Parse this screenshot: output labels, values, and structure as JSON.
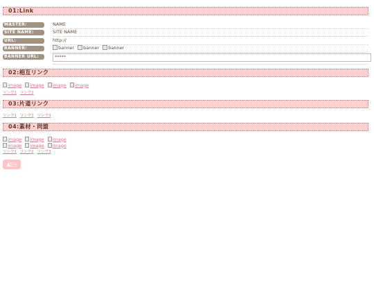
{
  "sections": {
    "link": {
      "title": "01:Link"
    },
    "mutual": {
      "title": "02:相互リンク"
    },
    "oneway": {
      "title": "03:片道リンク"
    },
    "material": {
      "title": "04:素材・同盟"
    }
  },
  "info": {
    "master": {
      "label": "MASTER:",
      "value": "NAME"
    },
    "site_name": {
      "label": "SITE NAME:",
      "value": "SITE NAME"
    },
    "url": {
      "label": "URL:",
      "value": "http://"
    },
    "banner": {
      "label": "BANNER:",
      "items": [
        "banner",
        "banner",
        "banner"
      ]
    },
    "banner_url": {
      "label": "BANNER URL:",
      "value": "*****"
    }
  },
  "mutual": {
    "images": [
      "image",
      "image",
      "image",
      "image"
    ],
    "links": [
      "リンク1",
      "リンク2"
    ]
  },
  "oneway": {
    "links": [
      "リンク1",
      "リンク2",
      "リンク3"
    ]
  },
  "material": {
    "images_row1": [
      "image",
      "image",
      "image"
    ],
    "images_row2": [
      "image",
      "image",
      "image"
    ],
    "links": [
      "リンク1",
      "リンク2",
      "リンク3"
    ]
  },
  "top_button": {
    "label": "▲top"
  }
}
